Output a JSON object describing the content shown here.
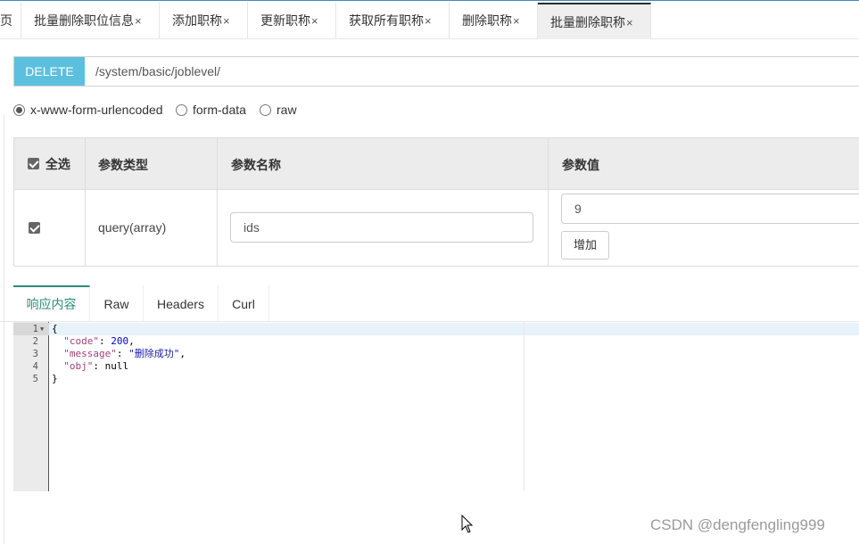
{
  "tabs": [
    {
      "label": "页",
      "closable": false,
      "active": false
    },
    {
      "label": "批量删除职位信息",
      "closable": true,
      "active": false
    },
    {
      "label": "添加职称",
      "closable": true,
      "active": false
    },
    {
      "label": "更新职称",
      "closable": true,
      "active": false
    },
    {
      "label": "获取所有职称",
      "closable": true,
      "active": false
    },
    {
      "label": "删除职称",
      "closable": true,
      "active": false
    },
    {
      "label": "批量删除职称",
      "closable": true,
      "active": true
    }
  ],
  "close_symbol": "×",
  "request": {
    "method": "DELETE",
    "url": "/system/basic/joblevel/"
  },
  "body_type": {
    "options": [
      "x-www-form-urlencoded",
      "form-data",
      "raw"
    ],
    "selected": "x-www-form-urlencoded"
  },
  "params_table": {
    "headers": {
      "select_all": "全选",
      "type": "参数类型",
      "name": "参数名称",
      "value": "参数值"
    },
    "rows": [
      {
        "checked": true,
        "type": "query(array)",
        "name": "ids",
        "value": "9",
        "add_label": "增加"
      }
    ]
  },
  "response_tabs": [
    "响应内容",
    "Raw",
    "Headers",
    "Curl"
  ],
  "active_response_tab": "响应内容",
  "editor": {
    "line_numbers": [
      "1",
      "2",
      "3",
      "4",
      "5"
    ],
    "lines": [
      {
        "text": "{"
      },
      {
        "key": "\"code\"",
        "sep": ": ",
        "value": "200",
        "end": ","
      },
      {
        "key": "\"message\"",
        "sep": ": ",
        "value": "\"删除成功\"",
        "end": ","
      },
      {
        "key": "\"obj\"",
        "sep": ": ",
        "value": "null",
        "end": ""
      },
      {
        "text": "}"
      }
    ]
  },
  "watermark": "CSDN @dengfengling999",
  "colors": {
    "method_bg": "#5bc0de",
    "active_response_tab": "#2e8b7a",
    "json_key": "#a23e7a",
    "json_number": "#0000cd",
    "json_string": "#1a1aa6"
  },
  "icons": [
    "radio-icon",
    "checkbox-icon",
    "close-icon",
    "fold-arrow-icon",
    "mouse-cursor-icon"
  ]
}
